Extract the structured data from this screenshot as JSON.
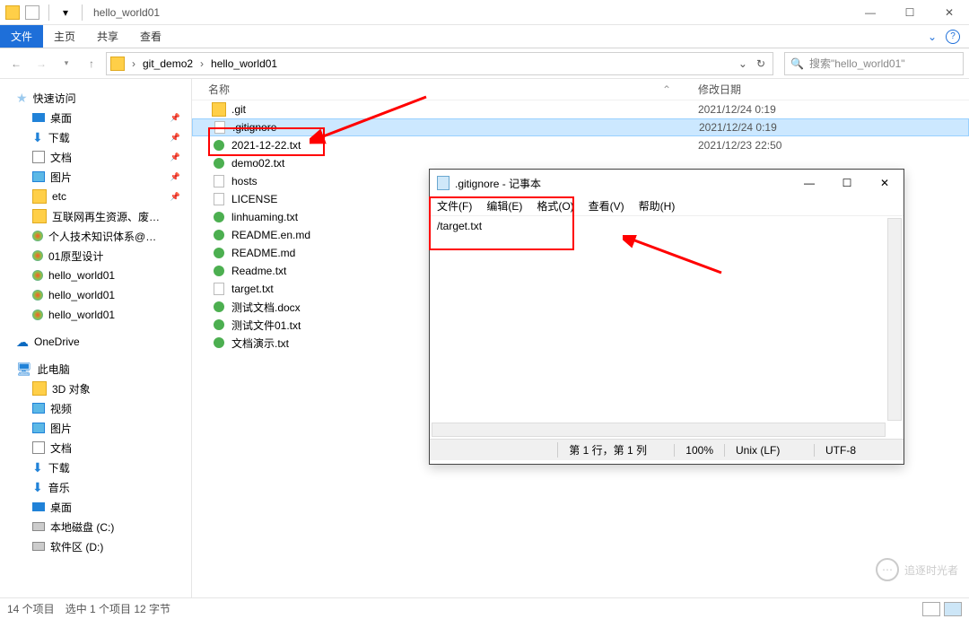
{
  "window": {
    "title": "hello_world01"
  },
  "ribbon": {
    "file": "文件",
    "home": "主页",
    "share": "共享",
    "view": "查看"
  },
  "breadcrumb": {
    "items": [
      "git_demo2",
      "hello_world01"
    ]
  },
  "search": {
    "placeholder": "搜索\"hello_world01\""
  },
  "columns": {
    "name": "名称",
    "date": "修改日期"
  },
  "sidebar": {
    "quick": {
      "label": "快速访问",
      "pinned": [
        {
          "label": "桌面",
          "icon": "desk"
        },
        {
          "label": "下载",
          "icon": "dl"
        },
        {
          "label": "文档",
          "icon": "doc"
        },
        {
          "label": "图片",
          "icon": "pic"
        },
        {
          "label": "etc",
          "icon": "folder"
        },
        {
          "label": "互联网再生资源、废品回收",
          "icon": "folder"
        },
        {
          "label": "个人技术知识体系@吴川三",
          "icon": "gg"
        },
        {
          "label": "01原型设计",
          "icon": "gg"
        },
        {
          "label": "hello_world01",
          "icon": "gg"
        },
        {
          "label": "hello_world01",
          "icon": "gg"
        },
        {
          "label": "hello_world01",
          "icon": "gg"
        }
      ]
    },
    "onedrive": "OneDrive",
    "pc": {
      "label": "此电脑",
      "items": [
        {
          "label": "3D 对象",
          "icon": "folder"
        },
        {
          "label": "视频",
          "icon": "pic"
        },
        {
          "label": "图片",
          "icon": "pic"
        },
        {
          "label": "文档",
          "icon": "doc"
        },
        {
          "label": "下载",
          "icon": "dl"
        },
        {
          "label": "音乐",
          "icon": "dl"
        },
        {
          "label": "桌面",
          "icon": "desk"
        },
        {
          "label": "本地磁盘 (C:)",
          "icon": "drive"
        },
        {
          "label": "软件区 (D:)",
          "icon": "drive"
        }
      ]
    }
  },
  "files": [
    {
      "name": ".git",
      "date": "2021/12/24 0:19",
      "icon": "folder"
    },
    {
      "name": ".gitignore",
      "date": "2021/12/24 0:19",
      "icon": "txt",
      "selected": true
    },
    {
      "name": "2021-12-22.txt",
      "date": "2021/12/23 22:50",
      "icon": "md"
    },
    {
      "name": "demo02.txt",
      "date": "",
      "icon": "md"
    },
    {
      "name": "hosts",
      "date": "",
      "icon": "txt"
    },
    {
      "name": "LICENSE",
      "date": "",
      "icon": "txt"
    },
    {
      "name": "linhuaming.txt",
      "date": "",
      "icon": "md"
    },
    {
      "name": "README.en.md",
      "date": "",
      "icon": "md"
    },
    {
      "name": "README.md",
      "date": "",
      "icon": "md"
    },
    {
      "name": "Readme.txt",
      "date": "",
      "icon": "md"
    },
    {
      "name": "target.txt",
      "date": "",
      "icon": "txt"
    },
    {
      "name": "测试文档.docx",
      "date": "",
      "icon": "md"
    },
    {
      "name": "测试文件01.txt",
      "date": "",
      "icon": "md"
    },
    {
      "name": "文档演示.txt",
      "date": "",
      "icon": "md"
    }
  ],
  "status": {
    "count": "14 个项目",
    "sel": "选中 1 个项目  12 字节"
  },
  "notepad": {
    "title": ".gitignore - 记事本",
    "menu": [
      "文件(F)",
      "编辑(E)",
      "格式(O)",
      "查看(V)",
      "帮助(H)"
    ],
    "content": "/target.txt",
    "status": {
      "pos": "第 1 行，第 1 列",
      "zoom": "100%",
      "eol": "Unix (LF)",
      "enc": "UTF-8"
    }
  },
  "watermark": "追逐时光者"
}
